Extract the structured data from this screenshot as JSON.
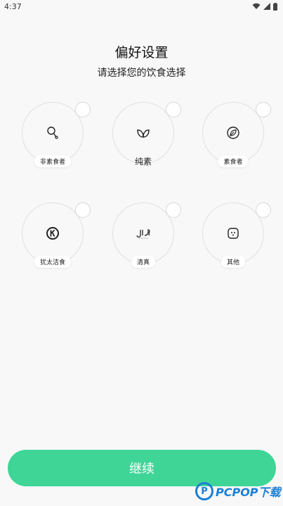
{
  "status_bar": {
    "time": "4:37"
  },
  "header": {
    "title": "偏好设置",
    "subtitle": "请选择您的饮食选择"
  },
  "options": [
    {
      "label": "非素食者",
      "icon": "drumstick-icon"
    },
    {
      "label": "纯素",
      "icon": "leaves-icon"
    },
    {
      "label": "素食者",
      "icon": "leaf-circle-icon"
    },
    {
      "label": "犹太洁食",
      "icon": "kosher-k-icon"
    },
    {
      "label": "清真",
      "icon": "halal-icon"
    },
    {
      "label": "其他",
      "icon": "dots-box-icon"
    }
  ],
  "continue_button": {
    "label": "继续"
  },
  "colors": {
    "accent": "#3fd597",
    "watermark": "#1a7fd6"
  },
  "watermark": {
    "logo_letter": "P",
    "text": "PCPOP下载"
  }
}
